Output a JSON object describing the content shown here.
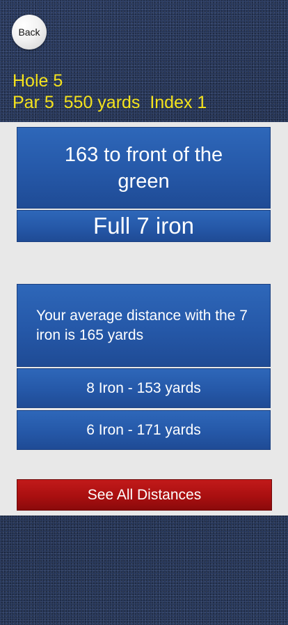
{
  "header": {
    "back_label": "Back",
    "hole": "Hole 5",
    "details": "Par 5  550 yards  Index 1"
  },
  "distance": {
    "to_green": "163 to front of the green",
    "club": "Full 7 iron"
  },
  "average": {
    "text": "Your average distance with the 7 iron is 165 yards"
  },
  "alternatives": [
    "8 Iron - 153 yards",
    "6 Iron - 171 yards"
  ],
  "actions": {
    "see_all": "See All Distances"
  },
  "colors": {
    "title_yellow": "#f4e21c",
    "box_blue": "#2558a8",
    "button_red": "#a90f10",
    "panel_grey": "#e8e8e8"
  }
}
